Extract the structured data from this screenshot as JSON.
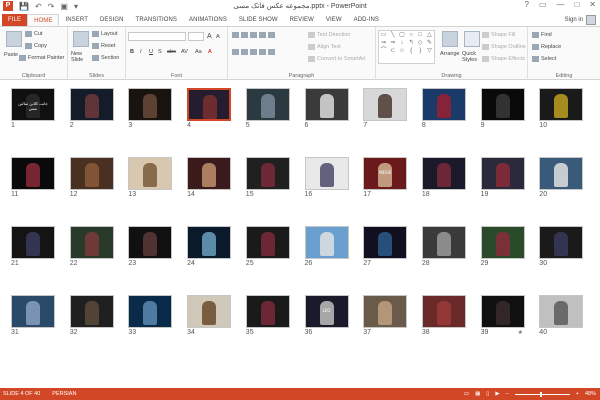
{
  "window": {
    "title": "مجموعه عکس فاتک مسی.pptx - PowerPoint",
    "app_icon": "P",
    "quick_access": [
      "save-icon",
      "undo-icon",
      "redo-icon",
      "start-from-beginning-icon",
      "customize-icon"
    ],
    "controls": [
      "?",
      "▭",
      "—",
      "□",
      "✕"
    ]
  },
  "tabs": [
    "FILE",
    "HOME",
    "INSERT",
    "DESIGN",
    "TRANSITIONS",
    "ANIMATIONS",
    "SLIDE SHOW",
    "REVIEW",
    "VIEW",
    "ADD-INS"
  ],
  "active_tab": "HOME",
  "signin": "Sign in",
  "ribbon": {
    "clipboard": {
      "label": "Clipboard",
      "paste": "Paste",
      "cut": "Cut",
      "copy": "Copy",
      "format_painter": "Format Painter"
    },
    "slides": {
      "label": "Slides",
      "new_slide": "New Slide",
      "layout": "Layout",
      "reset": "Reset",
      "section": "Section"
    },
    "font": {
      "label": "Font",
      "buttons": [
        "B",
        "I",
        "U",
        "S",
        "abc",
        "AV",
        "Aa",
        "A"
      ],
      "grow": "A",
      "shrink": "A"
    },
    "paragraph": {
      "label": "Paragraph",
      "text_direction": "Text Direction",
      "align_text": "Align Text",
      "smartart": "Convert to SmartArt"
    },
    "drawing": {
      "label": "Drawing",
      "arrange": "Arrange",
      "quick_styles": "Quick Styles",
      "shape_fill": "Shape Fill",
      "shape_outline": "Shape Outline",
      "shape_effects": "Shape Effects",
      "shapes": [
        "▭",
        "╲",
        "▢",
        "○",
        "□",
        "△",
        "⇒",
        "⇒",
        "↓",
        "↰",
        "◇",
        "✎",
        "⌒",
        "⊂",
        "☆",
        "{",
        "}",
        "▽"
      ]
    },
    "editing": {
      "label": "Editing",
      "find": "Find",
      "replace": "Replace",
      "select": "Select"
    }
  },
  "slides": [
    {
      "n": "1",
      "bg": "#101010",
      "fig": "#2a2a2a",
      "cap": "جانت کلاین سالین سس",
      "star": ""
    },
    {
      "n": "2",
      "bg": "#141c2a",
      "fig": "#6d3a3a",
      "cap": "",
      "star": ""
    },
    {
      "n": "3",
      "bg": "#1a1410",
      "fig": "#6a4a3a",
      "cap": "",
      "star": ""
    },
    {
      "n": "4",
      "bg": "#261c30",
      "fig": "#7a3030",
      "cap": "",
      "star": ""
    },
    {
      "n": "5",
      "bg": "#2a3a40",
      "fig": "#7a8a9a",
      "cap": "",
      "star": ""
    },
    {
      "n": "6",
      "bg": "#3a3a3a",
      "fig": "#dcdcdc",
      "cap": "",
      "star": ""
    },
    {
      "n": "7",
      "bg": "#d8d8d8",
      "fig": "#4a3a30",
      "cap": "",
      "star": ""
    },
    {
      "n": "8",
      "bg": "#1a3a6a",
      "fig": "#9a2030",
      "cap": "",
      "star": ""
    },
    {
      "n": "9",
      "bg": "#0a0a0a",
      "fig": "#3a3a3a",
      "cap": "",
      "star": ""
    },
    {
      "n": "10",
      "bg": "#1a1a1a",
      "fig": "#c0a020",
      "cap": "",
      "star": ""
    },
    {
      "n": "11",
      "bg": "#0a0a0a",
      "fig": "#8a2a3a",
      "cap": "",
      "star": ""
    },
    {
      "n": "12",
      "bg": "#4a3020",
      "fig": "#8a5a3a",
      "cap": "",
      "star": ""
    },
    {
      "n": "13",
      "bg": "#d8c8b0",
      "fig": "#7a5a3a",
      "cap": "",
      "star": ""
    },
    {
      "n": "14",
      "bg": "#3a1a1a",
      "fig": "#c09070",
      "cap": "",
      "star": ""
    },
    {
      "n": "15",
      "bg": "#202020",
      "fig": "#7a2a3a",
      "cap": "",
      "star": ""
    },
    {
      "n": "16",
      "bg": "#e8e8e8",
      "fig": "#4a4a6a",
      "cap": "",
      "star": ""
    },
    {
      "n": "17",
      "bg": "#6a1a1a",
      "fig": "#d0b090",
      "cap": "MESSI",
      "star": ""
    },
    {
      "n": "18",
      "bg": "#1a1a2a",
      "fig": "#7a2a3a",
      "cap": "",
      "star": ""
    },
    {
      "n": "19",
      "bg": "#2a2a3a",
      "fig": "#8a2a3a",
      "cap": "",
      "star": ""
    },
    {
      "n": "20",
      "bg": "#3a5a7a",
      "fig": "#e0e0e0",
      "cap": "",
      "star": ""
    },
    {
      "n": "21",
      "bg": "#141414",
      "fig": "#3a3a5a",
      "cap": "",
      "star": ""
    },
    {
      "n": "22",
      "bg": "#2a3a2a",
      "fig": "#7a3a3a",
      "cap": "",
      "star": ""
    },
    {
      "n": "23",
      "bg": "#101010",
      "fig": "#5a3a3a",
      "cap": "",
      "star": ""
    },
    {
      "n": "24",
      "bg": "#0a1a2a",
      "fig": "#6aa0c0",
      "cap": "",
      "star": ""
    },
    {
      "n": "25",
      "bg": "#1a1a1a",
      "fig": "#7a2a3a",
      "cap": "",
      "star": ""
    },
    {
      "n": "26",
      "bg": "#6aa0d0",
      "fig": "#e0e0e0",
      "cap": "",
      "star": ""
    },
    {
      "n": "27",
      "bg": "#101020",
      "fig": "#2a5a8a",
      "cap": "",
      "star": ""
    },
    {
      "n": "28",
      "bg": "#3a3a3a",
      "fig": "#9a9a9a",
      "cap": "",
      "star": ""
    },
    {
      "n": "29",
      "bg": "#2a4a2a",
      "fig": "#8a2a3a",
      "cap": "",
      "star": ""
    },
    {
      "n": "30",
      "bg": "#1a1a1a",
      "fig": "#3a3a5a",
      "cap": "",
      "star": ""
    },
    {
      "n": "31",
      "bg": "#2a4a6a",
      "fig": "#8aa0c0",
      "cap": "",
      "star": ""
    },
    {
      "n": "32",
      "bg": "#202020",
      "fig": "#5a4a3a",
      "cap": "",
      "star": ""
    },
    {
      "n": "33",
      "bg": "#0a2a4a",
      "fig": "#5a8ab0",
      "cap": "",
      "star": ""
    },
    {
      "n": "34",
      "bg": "#d0c8b8",
      "fig": "#6a4a2a",
      "cap": "",
      "star": ""
    },
    {
      "n": "35",
      "bg": "#1a1a1a",
      "fig": "#7a2a3a",
      "cap": "",
      "star": ""
    },
    {
      "n": "36",
      "bg": "#1a1a2a",
      "fig": "#c0c0c0",
      "cap": "LEO",
      "star": ""
    },
    {
      "n": "37",
      "bg": "#6a5a4a",
      "fig": "#c0a080",
      "cap": "",
      "star": ""
    },
    {
      "n": "38",
      "bg": "#6a2a2a",
      "fig": "#9a3a3a",
      "cap": "",
      "star": ""
    },
    {
      "n": "39",
      "bg": "#101010",
      "fig": "#3a2a2a",
      "cap": "",
      "star": "★"
    },
    {
      "n": "40",
      "bg": "#c0c0c0",
      "fig": "#5a5a5a",
      "cap": "",
      "star": ""
    }
  ],
  "status": {
    "slide_indicator": "SLIDE 4 OF 40",
    "language": "PERSIAN",
    "zoom_level": "48%",
    "zoom_fraction": 0.48
  },
  "colors": {
    "accent": "#d24726",
    "selection": "#d24726"
  }
}
